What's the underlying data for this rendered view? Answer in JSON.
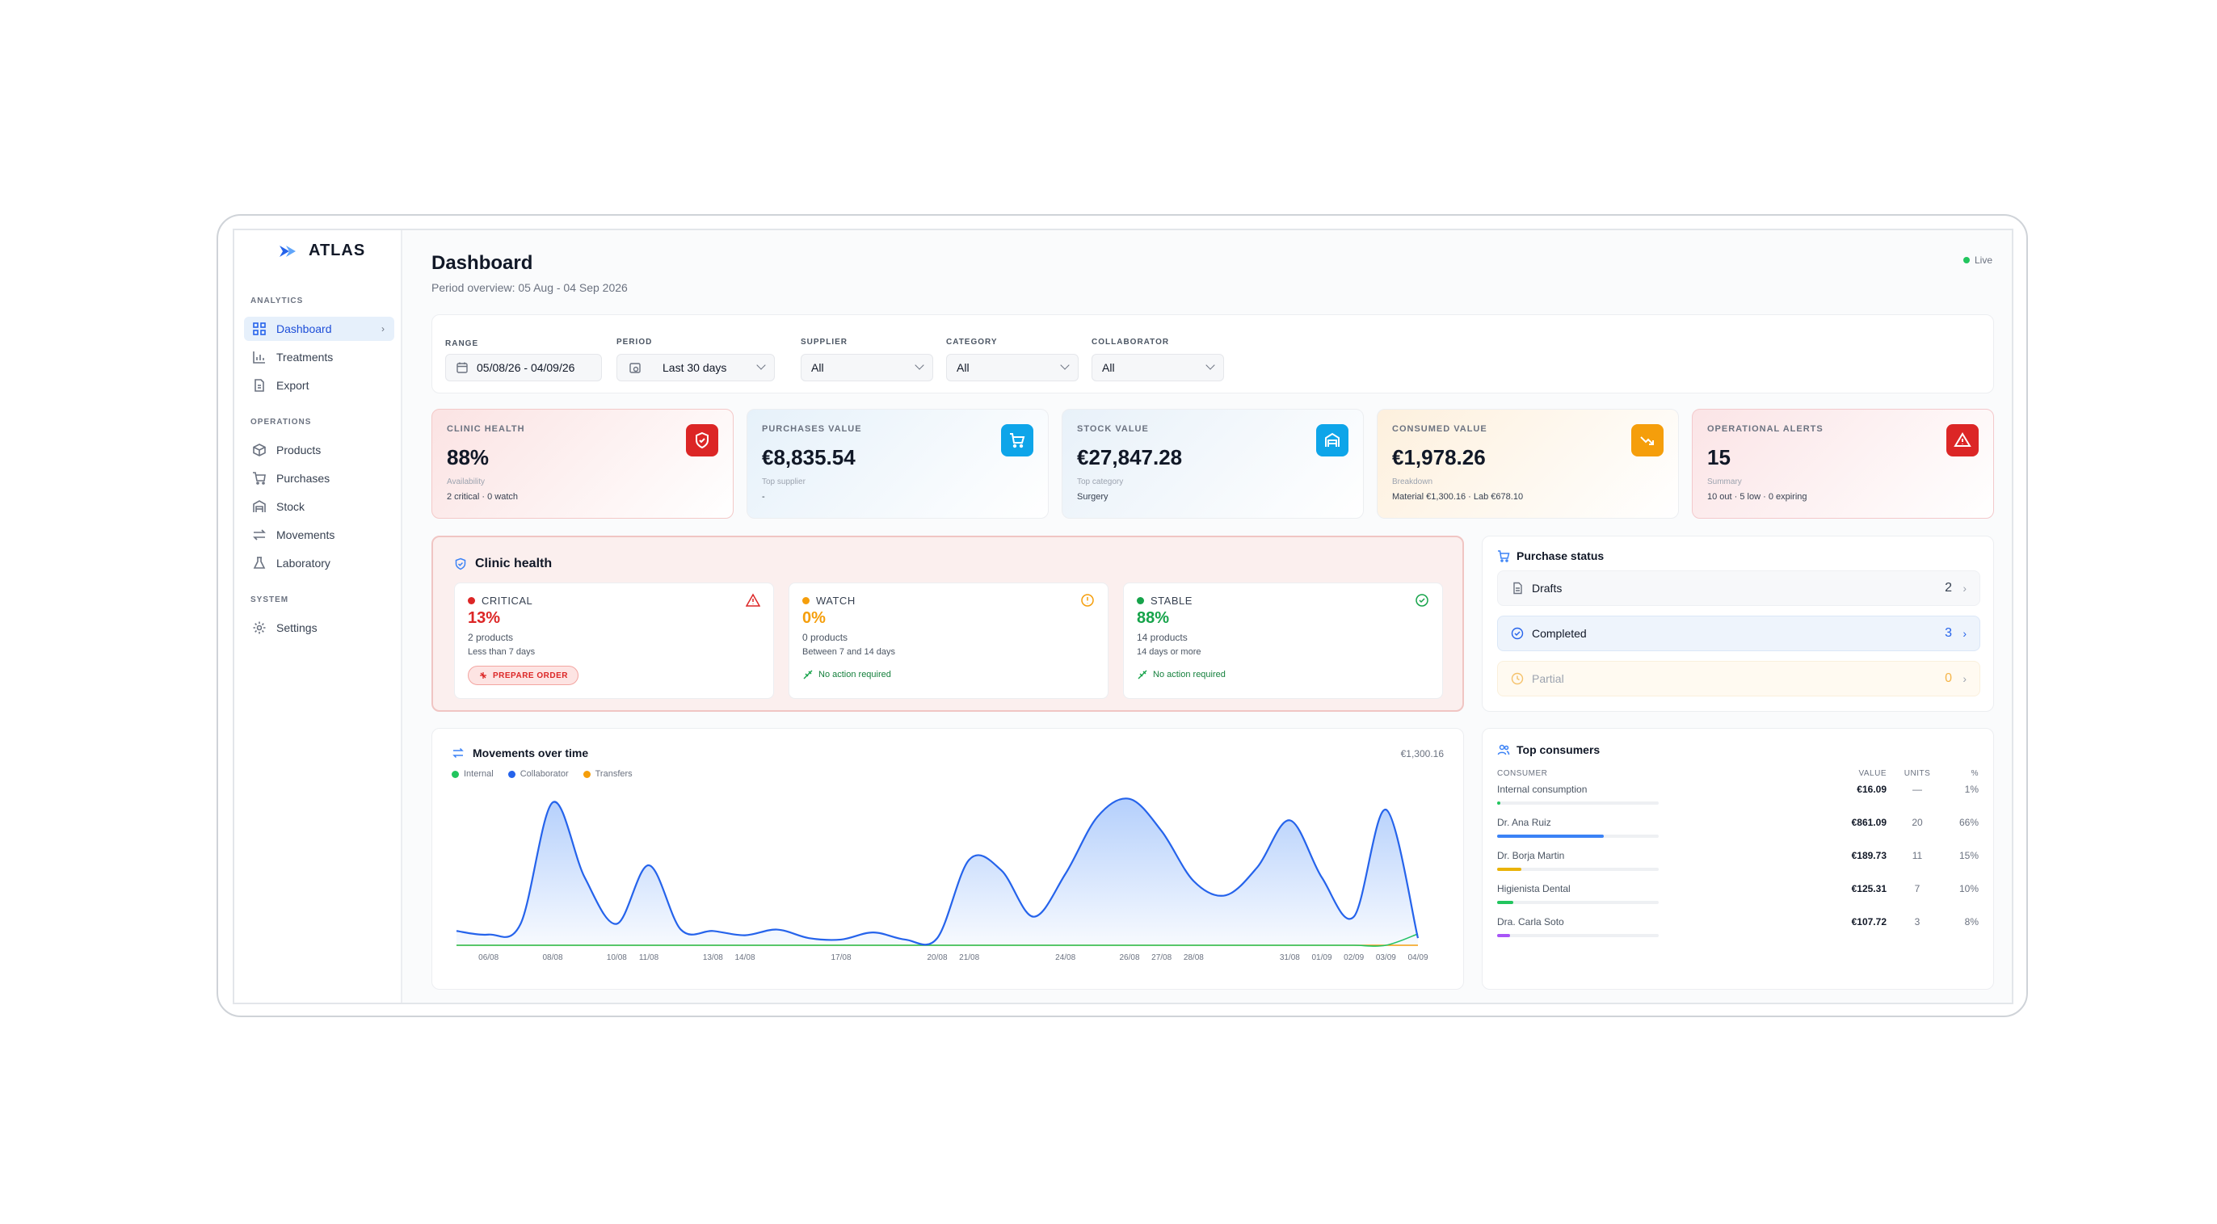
{
  "app": {
    "logo": "ATLAS",
    "live": "Live"
  },
  "sidebar": {
    "sections": [
      {
        "label": "ANALYTICS",
        "items": [
          {
            "label": "Dashboard",
            "icon": "grid-icon",
            "active": true
          },
          {
            "label": "Treatments",
            "icon": "bar-chart-icon"
          },
          {
            "label": "Export",
            "icon": "file-icon"
          }
        ]
      },
      {
        "label": "OPERATIONS",
        "items": [
          {
            "label": "Products",
            "icon": "box-icon"
          },
          {
            "label": "Purchases",
            "icon": "cart-icon"
          },
          {
            "label": "Stock",
            "icon": "warehouse-icon"
          },
          {
            "label": "Movements",
            "icon": "arrows-icon"
          },
          {
            "label": "Laboratory",
            "icon": "flask-icon"
          }
        ]
      },
      {
        "label": "SYSTEM",
        "items": [
          {
            "label": "Settings",
            "icon": "gear-icon"
          }
        ]
      }
    ]
  },
  "header": {
    "title": "Dashboard",
    "subtitle": "Period overview: 05 Aug - 04 Sep 2026"
  },
  "filters": {
    "range": {
      "label": "RANGE",
      "value": "05/08/26 - 04/09/26"
    },
    "period": {
      "label": "PERIOD",
      "value": "Last 30 days"
    },
    "supplier": {
      "label": "SUPPLIER",
      "value": "All"
    },
    "category": {
      "label": "CATEGORY",
      "value": "All"
    },
    "collaborator": {
      "label": "COLLABORATOR",
      "value": "All"
    }
  },
  "kpis": [
    {
      "label": "CLINIC HEALTH",
      "value": "88%",
      "sub": "Availability",
      "note": "2 critical · 0 watch",
      "icon": "shield-icon",
      "color": "#dc2626",
      "bg": "#fbe9e9"
    },
    {
      "label": "PURCHASES VALUE",
      "value": "€8,835.54",
      "sub": "Top supplier",
      "note": "-",
      "icon": "cart-icon",
      "color": "#0ea5e9",
      "bg": "#eaf4fb"
    },
    {
      "label": "STOCK VALUE",
      "value": "€27,847.28",
      "sub": "Top category",
      "note": "Surgery",
      "icon": "warehouse-icon",
      "color": "#0ea5e9",
      "bg": "#ecf4fa"
    },
    {
      "label": "CONSUMED VALUE",
      "value": "€1,978.26",
      "sub": "Breakdown",
      "note": "Material €1,300.16 · Lab €678.10",
      "icon": "trend-down-icon",
      "color": "#f59e0b",
      "bg": "#fdf3e6"
    },
    {
      "label": "OPERATIONAL ALERTS",
      "value": "15",
      "sub": "Summary",
      "note": "10 out · 5 low · 0 expiring",
      "icon": "alert-triangle-icon",
      "color": "#dc2626",
      "bg": "#fbe9ea"
    }
  ],
  "health": {
    "title": "Clinic health",
    "cards": [
      {
        "label": "CRITICAL",
        "pct": "13%",
        "products": "2 products",
        "range": "Less than 7 days",
        "action": "PREPARE ORDER",
        "color": "#dc2626"
      },
      {
        "label": "WATCH",
        "pct": "0%",
        "products": "0 products",
        "range": "Between 7 and 14 days",
        "action": "No action required",
        "color": "#f59e0b"
      },
      {
        "label": "STABLE",
        "pct": "88%",
        "products": "14 products",
        "range": "14 days or more",
        "action": "No action required",
        "color": "#16a34a"
      }
    ]
  },
  "purchase_status": {
    "title": "Purchase status",
    "rows": [
      {
        "label": "Drafts",
        "count": "2"
      },
      {
        "label": "Completed",
        "count": "3"
      },
      {
        "label": "Partial",
        "count": "0"
      }
    ]
  },
  "movements": {
    "title": "Movements over time",
    "total": "€1,300.16"
  },
  "chart_data": {
    "type": "area",
    "title": "Movements over time",
    "x": [
      "05/08",
      "06/08",
      "07/08",
      "08/08",
      "09/08",
      "10/08",
      "11/08",
      "12/08",
      "13/08",
      "14/08",
      "15/08",
      "16/08",
      "17/08",
      "18/08",
      "19/08",
      "20/08",
      "21/08",
      "22/08",
      "23/08",
      "24/08",
      "25/08",
      "26/08",
      "27/08",
      "28/08",
      "29/08",
      "30/08",
      "31/08",
      "01/09",
      "02/09",
      "03/09",
      "04/09"
    ],
    "tick_labels": [
      "06/08",
      "08/08",
      "10/08",
      "11/08",
      "13/08",
      "14/08",
      "17/08",
      "20/08",
      "21/08",
      "24/08",
      "26/08",
      "27/08",
      "28/08",
      "31/08",
      "01/09",
      "02/09",
      "03/09",
      "04/09"
    ],
    "series": [
      {
        "name": "Internal",
        "color": "#22c55e",
        "values": [
          0,
          0,
          0,
          0,
          0,
          0,
          0,
          0,
          0,
          0,
          0,
          0,
          0,
          0,
          0,
          0,
          0,
          0,
          0,
          0,
          0,
          0,
          0,
          0,
          0,
          0,
          0,
          0,
          0,
          0,
          16
        ]
      },
      {
        "name": "Collaborator",
        "color": "#2563eb",
        "values": [
          20,
          15,
          30,
          200,
          95,
          30,
          112,
          22,
          20,
          14,
          22,
          10,
          8,
          18,
          8,
          10,
          120,
          105,
          40,
          100,
          180,
          205,
          160,
          90,
          70,
          110,
          175,
          95,
          40,
          190,
          10
        ]
      },
      {
        "name": "Transfers",
        "color": "#f59e0b",
        "values": [
          0,
          0,
          0,
          0,
          0,
          0,
          0,
          0,
          0,
          0,
          0,
          0,
          0,
          0,
          0,
          0,
          0,
          0,
          0,
          0,
          0,
          0,
          0,
          0,
          0,
          0,
          0,
          0,
          0,
          0,
          0
        ]
      }
    ],
    "grid": false,
    "legend": "top-left"
  },
  "consumers": {
    "title": "Top consumers",
    "headers": {
      "consumer": "CONSUMER",
      "value": "VALUE",
      "units": "UNITS",
      "pct": "%"
    },
    "rows": [
      {
        "name": "Internal consumption",
        "value": "€16.09",
        "units": "—",
        "pct": "1%",
        "share": 0.01,
        "color": "#22c55e"
      },
      {
        "name": "Dr. Ana Ruiz",
        "value": "€861.09",
        "units": "20",
        "pct": "66%",
        "share": 0.66,
        "color": "#3b82f6"
      },
      {
        "name": "Dr. Borja Martin",
        "value": "€189.73",
        "units": "11",
        "pct": "15%",
        "share": 0.15,
        "color": "#eab308"
      },
      {
        "name": "Higienista Dental",
        "value": "€125.31",
        "units": "7",
        "pct": "10%",
        "share": 0.1,
        "color": "#22c55e"
      },
      {
        "name": "Dra. Carla Soto",
        "value": "€107.72",
        "units": "3",
        "pct": "8%",
        "share": 0.08,
        "color": "#a855f7"
      }
    ]
  }
}
